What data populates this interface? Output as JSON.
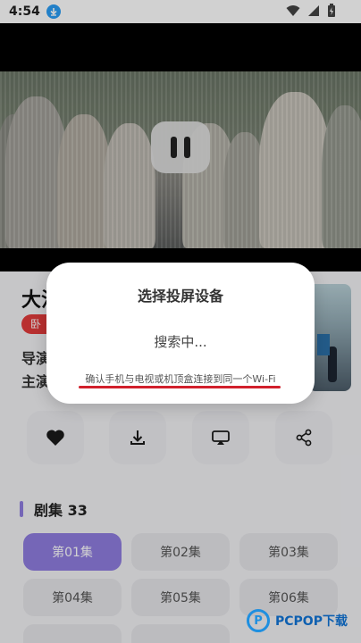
{
  "status_bar": {
    "time": "4:54"
  },
  "video": {
    "state": "paused"
  },
  "detail": {
    "title": "大江",
    "tag": "卧",
    "director_label": "导演",
    "cast_label": "主演"
  },
  "actions": [
    {
      "icon": "heart-icon"
    },
    {
      "icon": "download-icon"
    },
    {
      "icon": "cast-icon"
    },
    {
      "icon": "share-icon"
    }
  ],
  "episodes": {
    "title": "剧集 33",
    "items": [
      {
        "label": "第01集",
        "active": true
      },
      {
        "label": "第02集",
        "active": false
      },
      {
        "label": "第03集",
        "active": false
      },
      {
        "label": "第04集",
        "active": false
      },
      {
        "label": "第05集",
        "active": false
      },
      {
        "label": "第06集",
        "active": false
      }
    ]
  },
  "dialog": {
    "title": "选择投屏设备",
    "status": "搜索中...",
    "hint": "确认手机与电视或机顶盒连接到同一个Wi-Fi"
  },
  "watermark": {
    "text": "PCPOP下载",
    "logo_letter": "P"
  },
  "colors": {
    "accent": "#8f7de0",
    "tag": "#e23b3b",
    "hint_underline": "#d11f2b"
  }
}
